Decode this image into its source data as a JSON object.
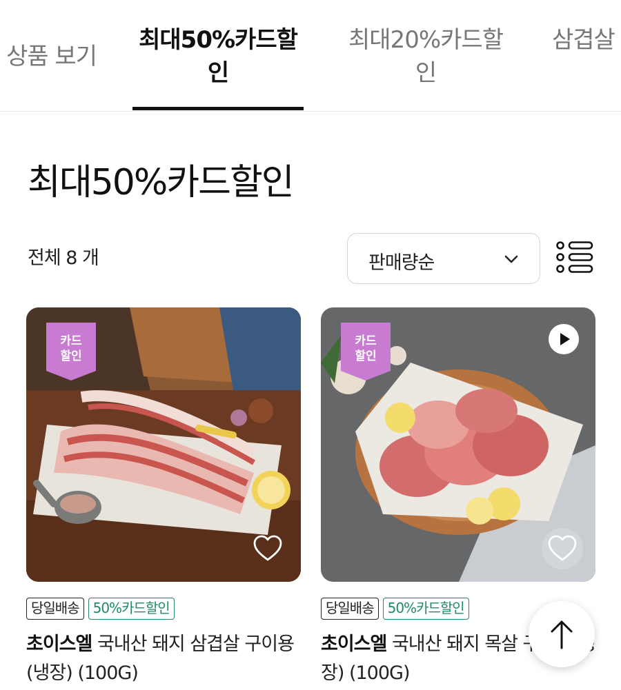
{
  "tabs": [
    {
      "label": "상품 보기",
      "active": false
    },
    {
      "label_line1": "최대50%카드할",
      "label_line2": "인",
      "active": true
    },
    {
      "label_line1": "최대20%카드할",
      "label_line2": "인",
      "active": false
    },
    {
      "label": "삼겹살",
      "active": false
    }
  ],
  "section": {
    "title": "최대50%카드할인",
    "total_count": "전체 8 개",
    "sort": {
      "selected": "판매량순"
    },
    "view_toggle_icon": "list-view-icon"
  },
  "products": [
    {
      "badge": {
        "line1": "카드",
        "line2": "할인"
      },
      "tags": [
        "당일배송",
        "50%카드할인"
      ],
      "brand": "초이스엘",
      "name": "국내산 돼지 삼겹살 구이용(냉장) (100G)",
      "has_video": false
    },
    {
      "badge": {
        "line1": "카드",
        "line2": "할인"
      },
      "tags": [
        "당일배송",
        "50%카드할인"
      ],
      "brand": "초이스엘",
      "name": "국내산 돼지 목살 구이용(냉장) (100G)",
      "has_video": true
    }
  ],
  "colors": {
    "badge": "#c77bd1",
    "tag_green": "#1f8a6b",
    "active_tab": "#111111",
    "inactive_tab": "#777777"
  }
}
